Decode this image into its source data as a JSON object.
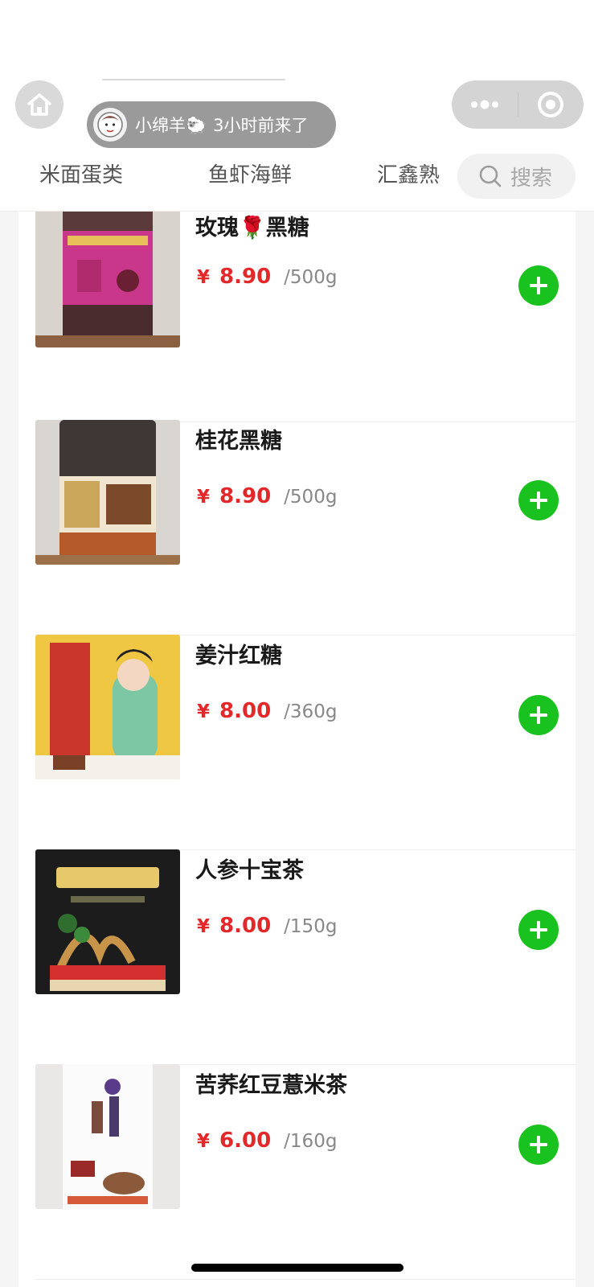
{
  "header": {
    "visitor": {
      "name": "小绵羊🐑",
      "time_text": "3小时前来了"
    },
    "tabs": [
      "米面蛋类",
      "鱼虾海鲜",
      "汇鑫熟"
    ],
    "search": {
      "label": "搜索"
    }
  },
  "products": [
    {
      "name": "玫瑰🌹黑糖",
      "currency": "¥",
      "price": "8.90",
      "unit": "/500g"
    },
    {
      "name": "桂花黑糖",
      "currency": "¥",
      "price": "8.90",
      "unit": "/500g"
    },
    {
      "name": "姜汁红糖",
      "currency": "¥",
      "price": "8.00",
      "unit": "/360g"
    },
    {
      "name": "人参十宝茶",
      "currency": "¥",
      "price": "8.00",
      "unit": "/150g"
    },
    {
      "name": "苦荞红豆薏米茶",
      "currency": "¥",
      "price": "6.00",
      "unit": "/160g"
    }
  ],
  "colors": {
    "price": "#e3282a",
    "add_button": "#19c21e",
    "visitor_pill": "#9a9a9a"
  },
  "icons": {
    "home": "home-icon",
    "more": "more-dots-icon",
    "close": "target-close-icon",
    "search": "search-icon",
    "add": "plus-icon"
  }
}
